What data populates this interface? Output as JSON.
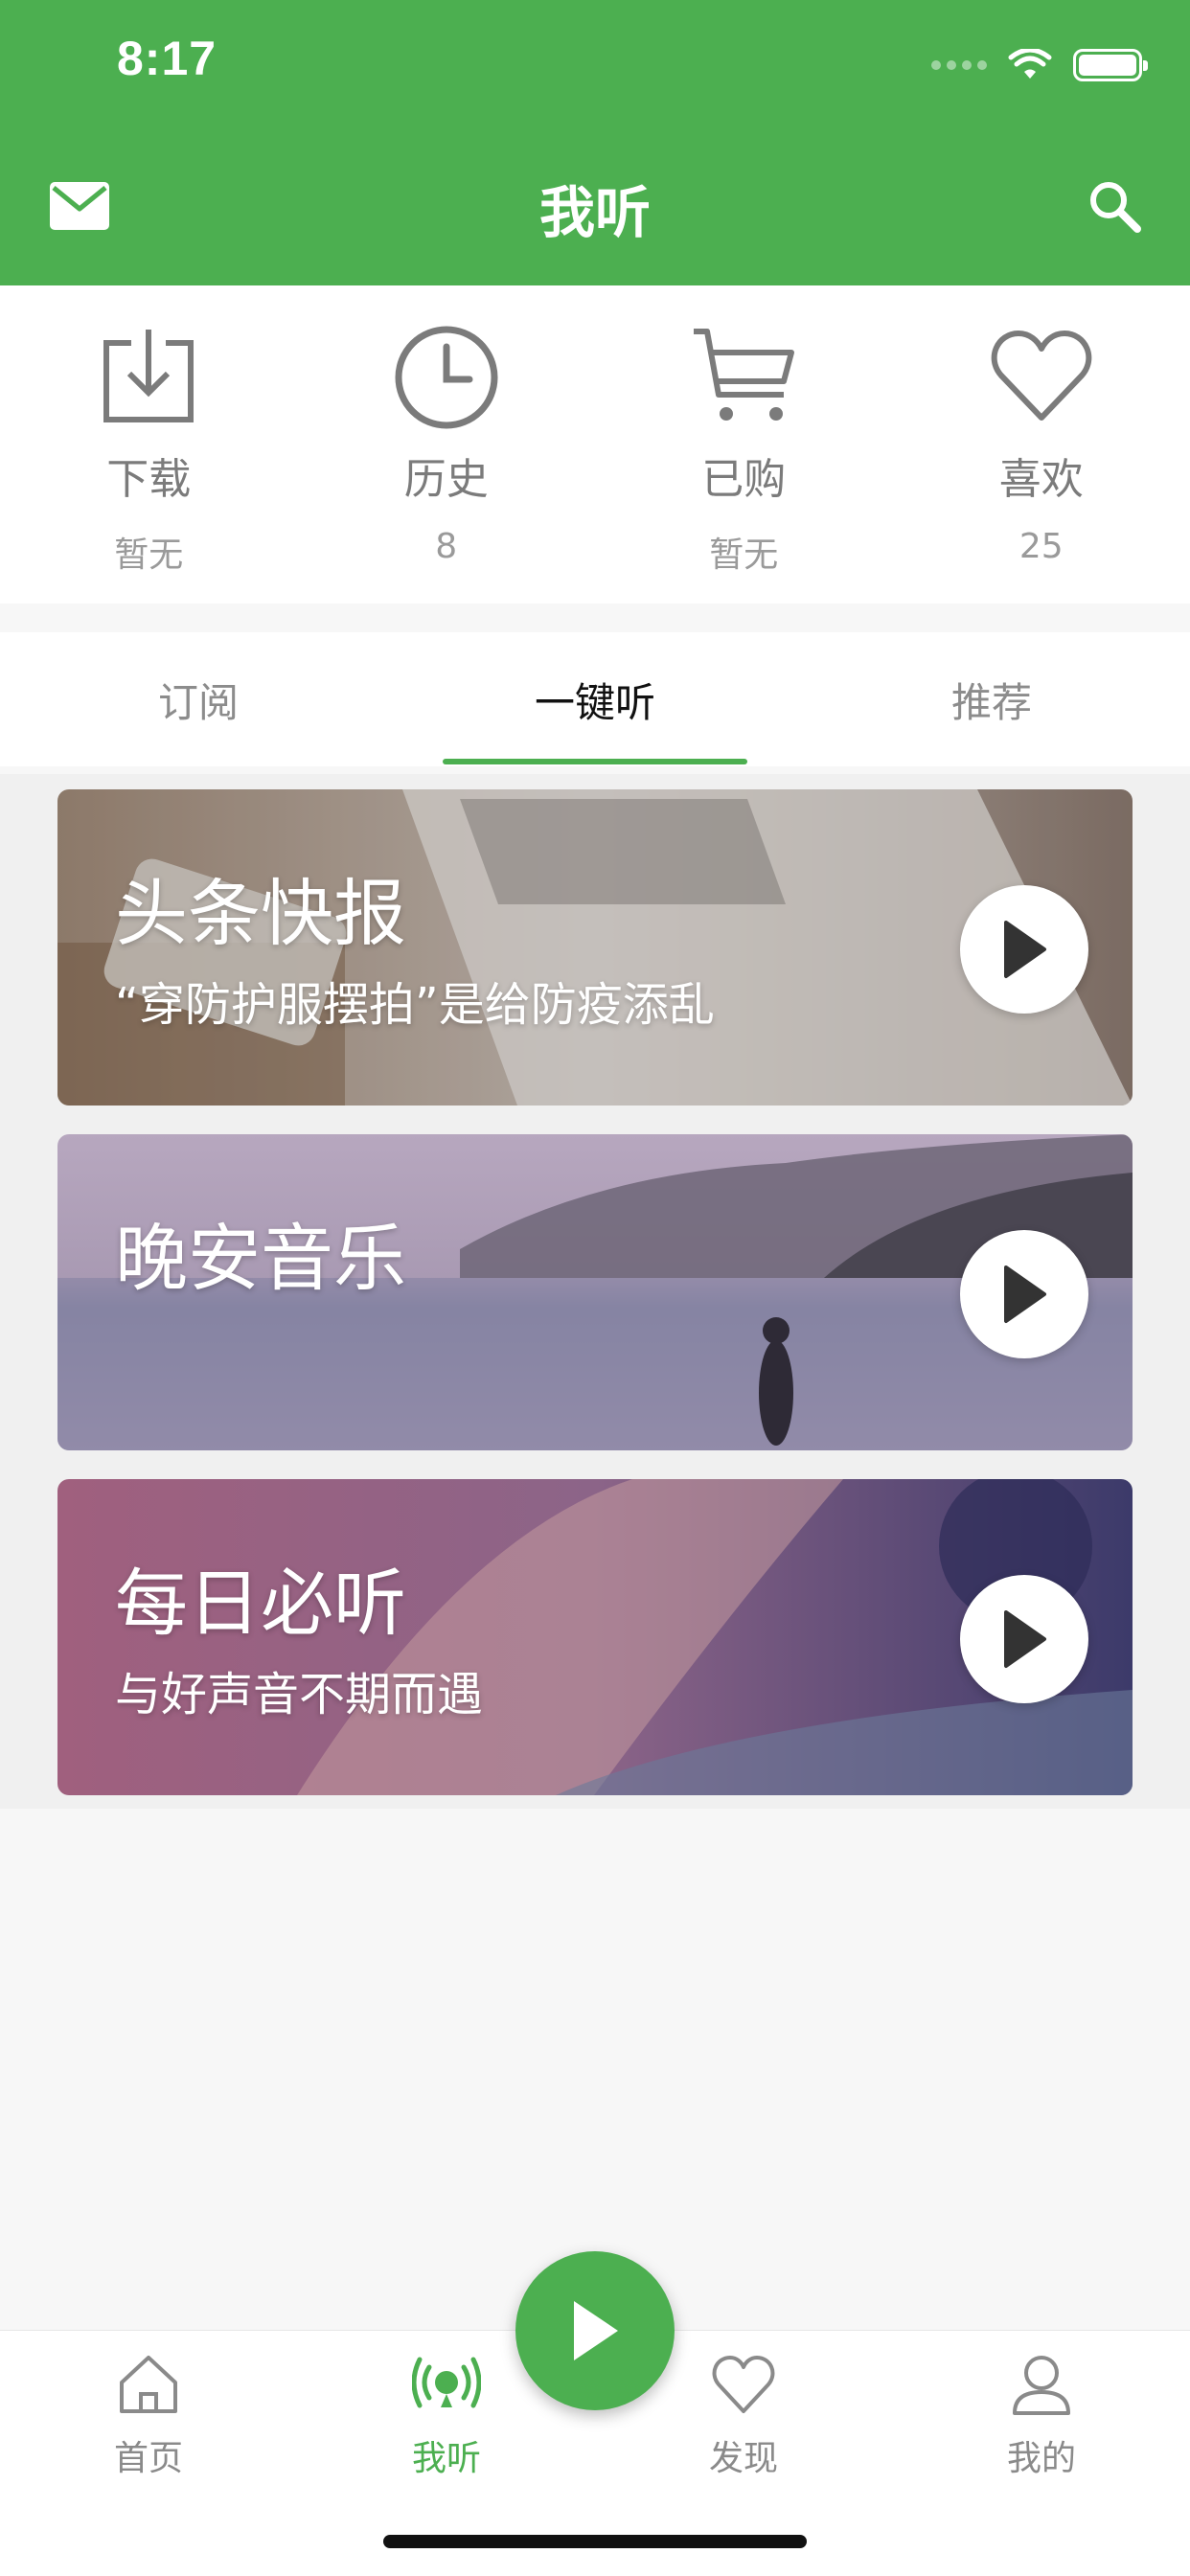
{
  "status_bar": {
    "time": "8:17"
  },
  "header": {
    "title": "我听",
    "mail_icon": "mail-icon",
    "search_icon": "search-icon"
  },
  "shortcuts": [
    {
      "label": "下载",
      "value": "暂无",
      "icon": "download-icon"
    },
    {
      "label": "历史",
      "value": "8",
      "icon": "clock-icon"
    },
    {
      "label": "已购",
      "value": "暂无",
      "icon": "cart-icon"
    },
    {
      "label": "喜欢",
      "value": "25",
      "icon": "heart-icon"
    }
  ],
  "tabs": [
    {
      "label": "订阅",
      "active": false
    },
    {
      "label": "一键听",
      "active": true
    },
    {
      "label": "推荐",
      "active": false
    }
  ],
  "cards": [
    {
      "title": "头条快报",
      "subtitle": "“穿防护服摆拍”是给防疫添乱"
    },
    {
      "title": "晚安音乐",
      "subtitle": ""
    },
    {
      "title": "每日必听",
      "subtitle": "与好声音不期而遇"
    }
  ],
  "bottom_nav": [
    {
      "label": "首页",
      "icon": "home-icon",
      "active": false
    },
    {
      "label": "我听",
      "icon": "broadcast-icon",
      "active": true
    },
    {
      "label": "发现",
      "icon": "heart-icon",
      "active": false
    },
    {
      "label": "我的",
      "icon": "user-icon",
      "active": false
    }
  ],
  "colors": {
    "accent": "#4caf50",
    "background": "#f7f7f7"
  }
}
